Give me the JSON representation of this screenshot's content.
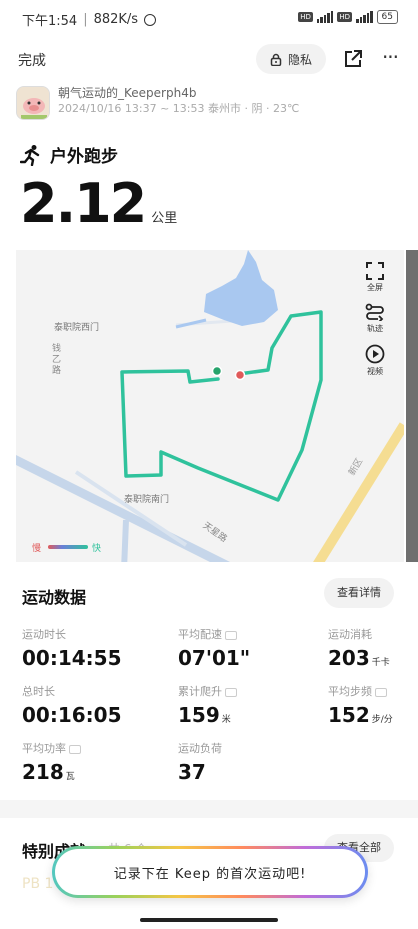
{
  "status_bar": {
    "time": "下午1:54",
    "network_speed": "882K/s",
    "battery": "65"
  },
  "top_bar": {
    "done_label": "完成",
    "privacy_label": "隐私"
  },
  "user": {
    "name": "朝气运动的_Keeperph4b",
    "meta": "2024/10/16  13:37 ~ 13:53  泰州市 · 阴 · 23℃"
  },
  "activity": {
    "type_label": "户外跑步",
    "distance": "2.12",
    "distance_unit": "公里"
  },
  "map": {
    "labels": {
      "west_gate": "泰职院西门",
      "road_west": "钱乙路",
      "south_gate": "泰职院南门",
      "road_south": "天星路",
      "road_east": "新区"
    },
    "tools": {
      "fullscreen": "全屏",
      "trajectory": "轨迹",
      "video": "视频"
    },
    "pace_legend": {
      "slow": "慢",
      "fast": "快"
    },
    "colors": {
      "route": "#2fc29c",
      "water": "#a9c8f0",
      "road": "#c6d6ea",
      "main_road": "#f5dd92",
      "start": "#27a36b",
      "end": "#e05a5a"
    }
  },
  "stats": {
    "title": "运动数据",
    "detail_label": "查看详情",
    "items": [
      {
        "label": "运动时长",
        "value": "00:14:55",
        "unit": ""
      },
      {
        "label": "平均配速",
        "value": "07'01\"",
        "unit": ""
      },
      {
        "label": "运动消耗",
        "value": "203",
        "unit": "千卡"
      },
      {
        "label": "总时长",
        "value": "00:16:05",
        "unit": ""
      },
      {
        "label": "累计爬升",
        "value": "159",
        "unit": "米"
      },
      {
        "label": "平均步频",
        "value": "152",
        "unit": "步/分"
      },
      {
        "label": "平均功率",
        "value": "218",
        "unit": "瓦"
      },
      {
        "label": "运动负荷",
        "value": "37",
        "unit": ""
      }
    ]
  },
  "personal_best": {
    "title": "特别成就",
    "count": "共 6 个",
    "view_all_label": "查看全部",
    "faded_text": "PB 1"
  },
  "record_banner": {
    "text": "记录下在 Keep 的首次运动吧!"
  }
}
